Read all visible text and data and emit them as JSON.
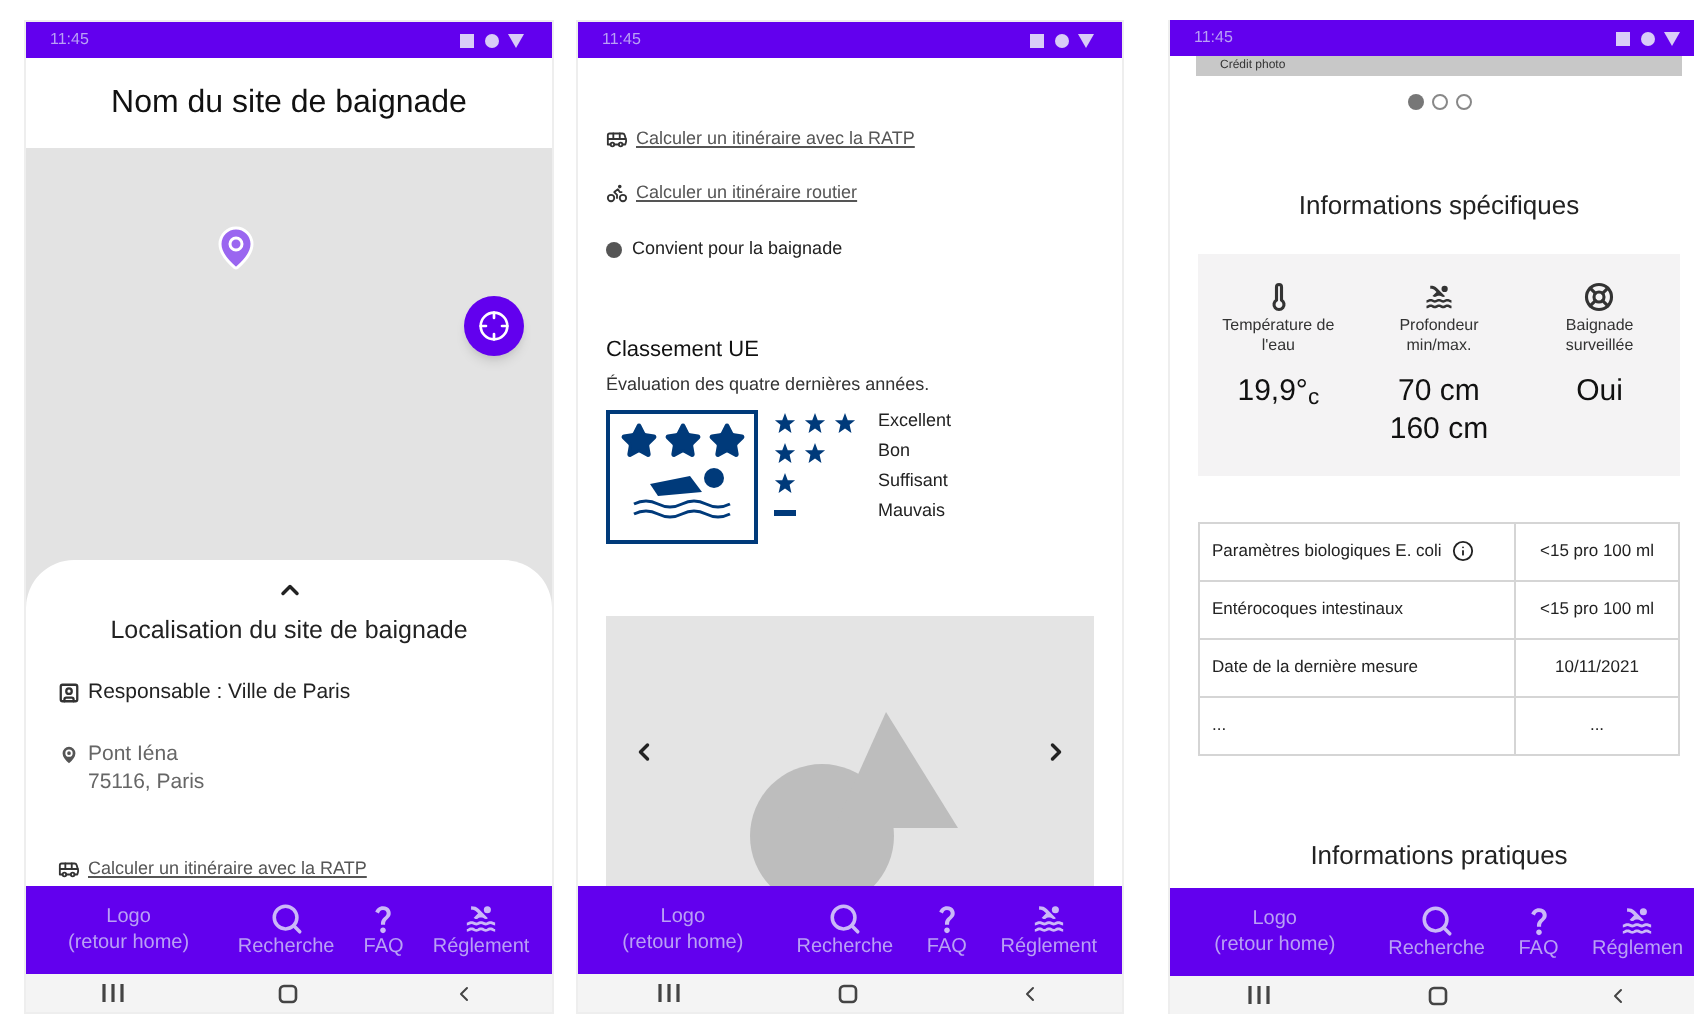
{
  "screen_1": {
    "status_bar": {
      "time": "11:45"
    },
    "title": "Nom du site de baignade",
    "sheet": {
      "heading": "Localisation du site de baignade",
      "responsible": "Responsable : Ville de Paris",
      "address": [
        "Pont Iéna",
        "75116, Paris"
      ],
      "link": "Calculer un itinéraire avec la RATP"
    },
    "bottom_nav": [
      {
        "kind": "logo",
        "label": "Logo\n(retour home)"
      },
      {
        "kind": "search",
        "label": "Recherche"
      },
      {
        "kind": "faq",
        "label": "FAQ"
      },
      {
        "kind": "rules",
        "label": "Réglement"
      }
    ]
  },
  "screen_2": {
    "status_bar": {
      "time": "11:45"
    },
    "links": [
      {
        "kind": "bus",
        "text": "Calculer un itinéraire avec la RATP"
      },
      {
        "kind": "bike",
        "text": "Calculer un itinéraire routier"
      }
    ],
    "status": "Convient pour la baignade",
    "classement": {
      "title": "Classement UE",
      "subtitle": "Évaluation des quatre dernières années.",
      "badge": {
        "stars": 3
      },
      "legend": [
        {
          "kind": "three_stars",
          "label": "Excellent"
        },
        {
          "kind": "two_stars",
          "label": "Bon"
        },
        {
          "kind": "one_star",
          "label": "Suffisant"
        },
        {
          "kind": "dash",
          "label": "Mauvais"
        }
      ]
    },
    "bottom_nav": [
      {
        "kind": "logo",
        "label": "Logo\n(retour home)"
      },
      {
        "kind": "search",
        "label": "Recherche"
      },
      {
        "kind": "faq",
        "label": "FAQ"
      },
      {
        "kind": "rules",
        "label": "Réglement"
      }
    ]
  },
  "screen_3": {
    "status_bar": {
      "time": "11:45"
    },
    "photo_credit": "Crédit photo",
    "carousel_dots": [
      {
        "selected": true
      },
      {
        "selected": false
      },
      {
        "selected": false
      }
    ],
    "specific_heading": "Informations spécifiques",
    "specific_items": [
      {
        "kind": "temperature",
        "label": "Température de l'eau",
        "values": [
          "19,9°$_{c}$"
        ]
      },
      {
        "kind": "depth",
        "label": "Profondeur min/max.",
        "values": [
          "70 cm",
          "160 cm"
        ]
      },
      {
        "kind": "lifeguard",
        "label": "Baignade surveillée",
        "values": [
          "Oui"
        ]
      }
    ],
    "table": {
      "rows": [
        {
          "label": "Paramètres biologiques E. coli",
          "value": "<15 pro 100 ml",
          "info": true
        },
        {
          "label": "Entérocoques intestinaux",
          "value": "<15 pro 100 ml",
          "info": false
        },
        {
          "label": "Date de la dernière mesure",
          "value": "10/11/2021",
          "info": false
        },
        {
          "label": "...",
          "value": "...",
          "info": false
        }
      ]
    },
    "practical_heading": "Informations pratiques",
    "bottom_nav": [
      {
        "kind": "logo",
        "label": "Logo\n(retour home)"
      },
      {
        "kind": "search",
        "label": "Recherche"
      },
      {
        "kind": "faq",
        "label": "FAQ"
      },
      {
        "kind": "rules",
        "label": "Réglemen"
      }
    ]
  }
}
